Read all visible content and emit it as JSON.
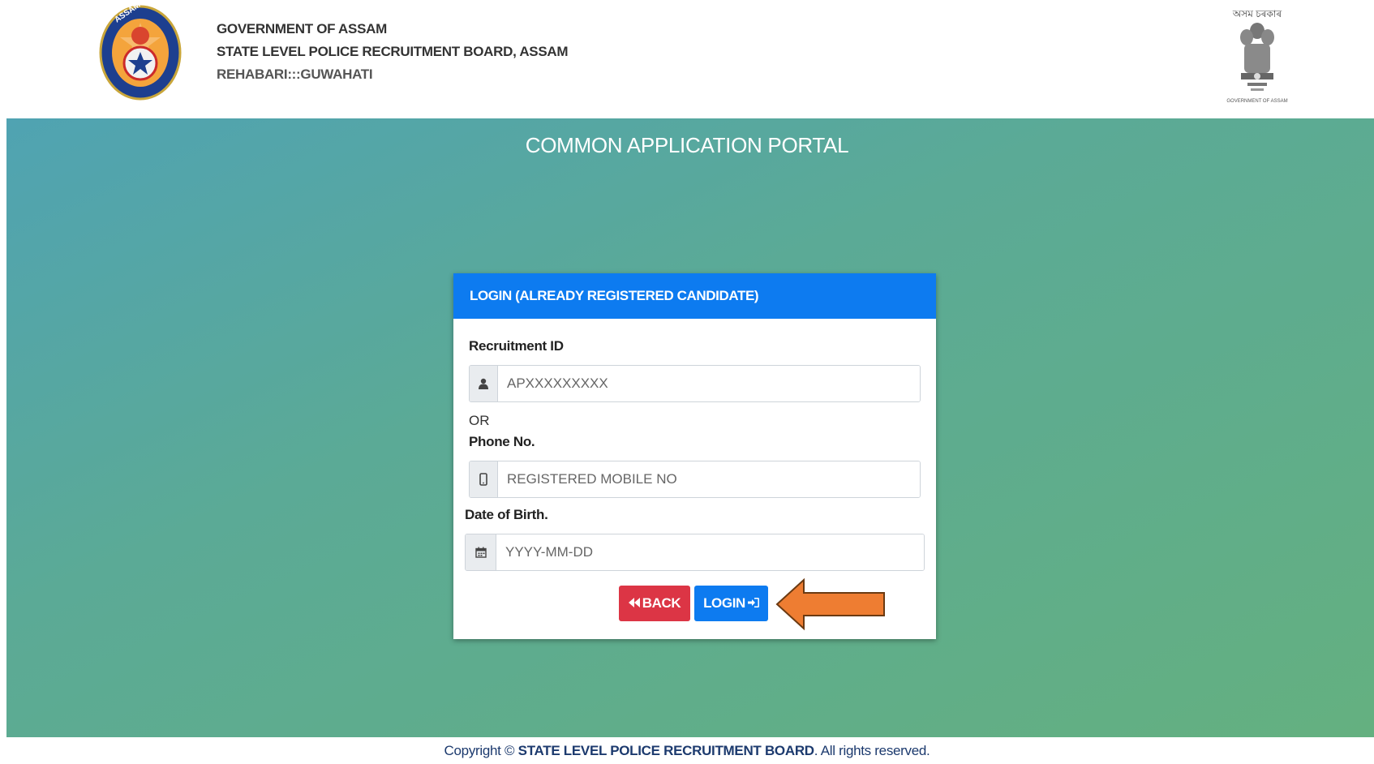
{
  "header": {
    "line1": "GOVERNMENT OF ASSAM",
    "line2": "STATE LEVEL POLICE RECRUITMENT BOARD, ASSAM",
    "line3": "REHABARI:::GUWAHATI",
    "left_logo_text": "ASSAM POLICE",
    "emblem_top_text": "অসম চৰকাৰ",
    "emblem_bottom_text": "GOVERNMENT OF ASSAM"
  },
  "portal_title": "COMMON APPLICATION PORTAL",
  "login_card": {
    "heading": "LOGIN (ALREADY REGISTERED CANDIDATE)",
    "recruitment_id_label": "Recruitment ID",
    "recruitment_id_placeholder": "APXXXXXXXXX",
    "or_text": "OR",
    "phone_label": "Phone No.",
    "phone_placeholder": "REGISTERED MOBILE NO",
    "dob_label": "Date of Birth.",
    "dob_placeholder": "YYYY-MM-DD",
    "back_label": "BACK",
    "login_label": "LOGIN"
  },
  "icons": {
    "user": "user-icon",
    "mobile": "mobile-icon",
    "calendar": "calendar-icon",
    "back": "double-chevron-left-icon",
    "login": "sign-in-icon",
    "annotation": "orange-arrow-icon"
  },
  "colors": {
    "primary": "#0d7bf0",
    "danger": "#dc3545",
    "annotation_arrow": "#ee7d32"
  },
  "footer": {
    "prefix": "Copyright © ",
    "org": "STATE LEVEL POLICE RECRUITMENT BOARD",
    "suffix": ". All rights reserved."
  }
}
